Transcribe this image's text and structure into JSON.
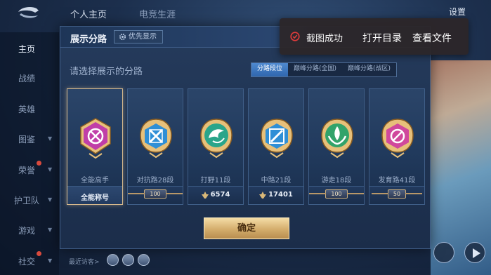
{
  "background": {
    "top_tabs": [
      "个人主页",
      "电竞生涯"
    ],
    "settings_label": "设置",
    "side_nav": [
      {
        "label": "主页",
        "active": true,
        "arrow": false,
        "badge": false
      },
      {
        "label": "战绩",
        "active": false,
        "arrow": false,
        "badge": false
      },
      {
        "label": "英雄",
        "active": false,
        "arrow": false,
        "badge": false
      },
      {
        "label": "图鉴",
        "active": false,
        "arrow": true,
        "badge": false
      },
      {
        "label": "荣誉",
        "active": false,
        "arrow": true,
        "badge": true
      },
      {
        "label": "护卫队",
        "active": false,
        "arrow": true,
        "badge": false
      },
      {
        "label": "游戏",
        "active": false,
        "arrow": true,
        "badge": false
      },
      {
        "label": "社交",
        "active": false,
        "arrow": true,
        "badge": true
      }
    ],
    "visitors_label": "最近访客>"
  },
  "modal": {
    "title": "展示分路",
    "priority_button": "优先显示",
    "subtitle": "请选择展示的分路",
    "segments": [
      {
        "label": "分路段位",
        "active": true
      },
      {
        "label": "巅峰分路(全国)",
        "active": false
      },
      {
        "label": "巅峰分路(战区)",
        "active": false
      }
    ],
    "cards": [
      {
        "name": "全能高手",
        "type": "text",
        "footer": "全能称号",
        "selected": true,
        "emblem": "allround",
        "color": "#c03ea8"
      },
      {
        "name": "对抗路28段",
        "type": "badge",
        "footer": "100",
        "selected": false,
        "emblem": "clash",
        "color": "#2f8fd6"
      },
      {
        "name": "打野11段",
        "type": "stat",
        "footer": "6574",
        "selected": false,
        "emblem": "jungle",
        "color": "#2aa58a"
      },
      {
        "name": "中路21段",
        "type": "stat",
        "footer": "17401",
        "selected": false,
        "emblem": "mid",
        "color": "#2f8fd6"
      },
      {
        "name": "游走18段",
        "type": "badge",
        "footer": "100",
        "selected": false,
        "emblem": "roam",
        "color": "#32a36a"
      },
      {
        "name": "发育路41段",
        "type": "badge",
        "footer": "50",
        "selected": false,
        "emblem": "farm",
        "color": "#d0489c"
      }
    ],
    "confirm_label": "确定"
  },
  "toast": {
    "message": "截图成功",
    "open_dir": "打开目录",
    "view_file": "查看文件",
    "icon": "check-circle-icon",
    "accent": "#e23b3b"
  }
}
